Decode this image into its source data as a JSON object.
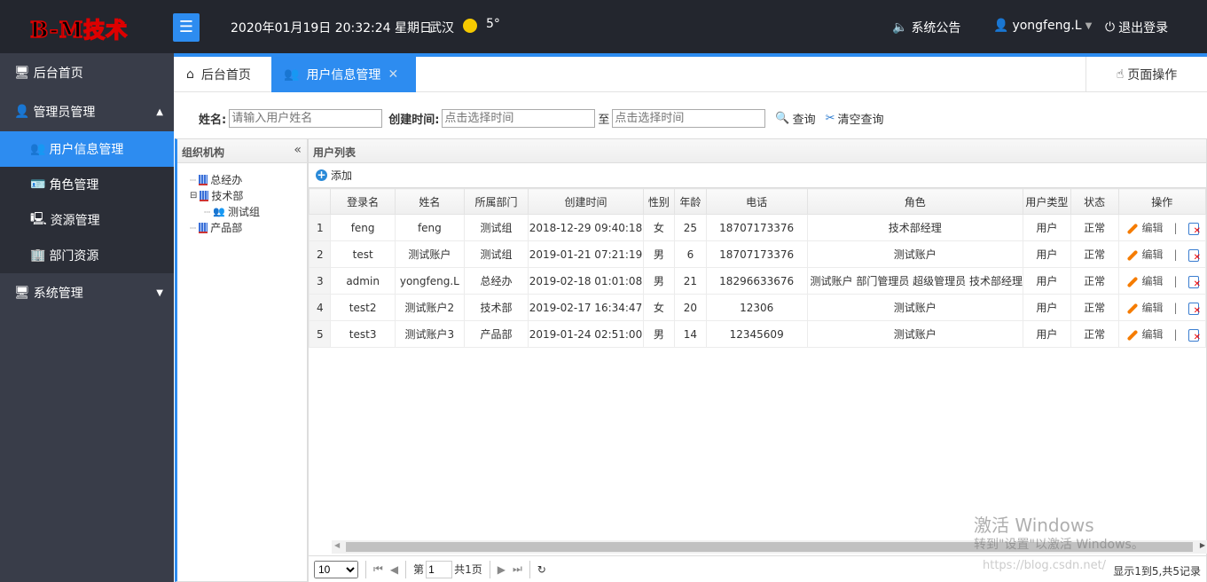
{
  "header": {
    "logo": "B-M技术",
    "menu_icon": "☰",
    "datetime": "2020年01月19日 20:32:24 星期日",
    "city": "武汉",
    "temperature": "5°",
    "announcement": "系统公告",
    "user": "yongfeng.L",
    "logout": "退出登录"
  },
  "sidebar": {
    "items": [
      {
        "label": "后台首页",
        "icon": "monitor-icon"
      },
      {
        "label": "管理员管理",
        "icon": "user-icon",
        "expanded": true
      },
      {
        "label": "用户信息管理",
        "icon": "users-icon",
        "active": true
      },
      {
        "label": "角色管理",
        "icon": "role-icon"
      },
      {
        "label": "资源管理",
        "icon": "resource-icon"
      },
      {
        "label": "部门资源",
        "icon": "department-icon"
      },
      {
        "label": "系统管理",
        "icon": "system-icon"
      }
    ]
  },
  "tabs": [
    {
      "label": "后台首页"
    },
    {
      "label": "用户信息管理",
      "active": true
    }
  ],
  "page_ops": "页面操作",
  "search": {
    "name_label": "姓名:",
    "name_placeholder": "请输入用户姓名",
    "time_label": "创建时间:",
    "time_placeholder": "点击选择时间",
    "to": "至",
    "query": "查询",
    "clear": "清空查询"
  },
  "org": {
    "title": "组织机构",
    "tree": [
      "总经办",
      "技术部",
      "测试组",
      "产品部"
    ]
  },
  "list": {
    "title": "用户列表",
    "add": "添加",
    "columns": [
      "",
      "登录名",
      "姓名",
      "所属部门",
      "创建时间",
      "性别",
      "年龄",
      "电话",
      "角色",
      "用户类型",
      "状态",
      "操作"
    ],
    "rows": [
      [
        "1",
        "feng",
        "feng",
        "测试组",
        "2018-12-29 09:40:18",
        "女",
        "25",
        "18707173376",
        "技术部经理",
        "用户",
        "正常"
      ],
      [
        "2",
        "test",
        "测试账户",
        "测试组",
        "2019-01-21 07:21:19",
        "男",
        "6",
        "18707173376",
        "测试账户",
        "用户",
        "正常"
      ],
      [
        "3",
        "admin",
        "yongfeng.L",
        "总经办",
        "2019-02-18 01:01:08",
        "男",
        "21",
        "18296633676",
        "测试账户 部门管理员 超级管理员 技术部经理",
        "用户",
        "正常"
      ],
      [
        "4",
        "test2",
        "测试账户2",
        "技术部",
        "2019-02-17 16:34:47",
        "女",
        "20",
        "12306",
        "测试账户",
        "用户",
        "正常"
      ],
      [
        "5",
        "test3",
        "测试账户3",
        "产品部",
        "2019-01-24 02:51:00",
        "男",
        "14",
        "12345609",
        "测试账户",
        "用户",
        "正常"
      ]
    ],
    "edit": "编辑",
    "divider": "|"
  },
  "pager": {
    "page_size": "10",
    "page_prefix": "第",
    "page": "1",
    "total_pages": "共1页",
    "info": "显示1到5,共5记录"
  },
  "watermark": {
    "line1": "激活 Windows",
    "line2": "转到\"设置\"以激活 Windows。",
    "url": "https://blog.csdn.net/"
  }
}
